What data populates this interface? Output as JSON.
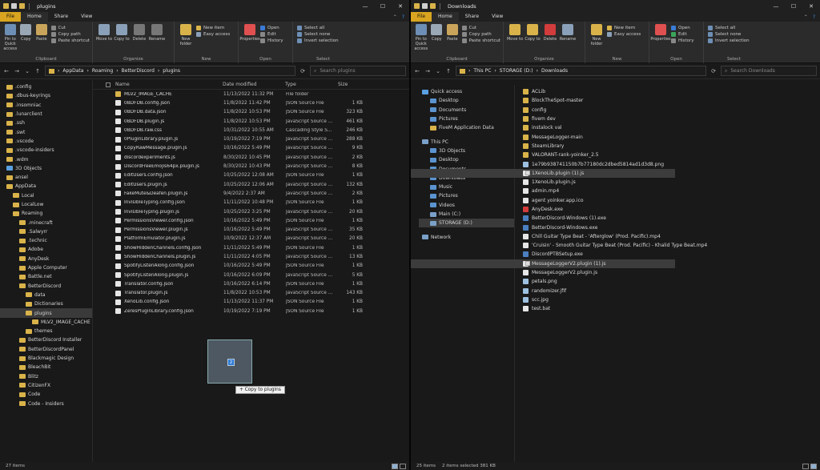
{
  "left": {
    "title": "plugins",
    "tabs": [
      "File",
      "Home",
      "Share",
      "View"
    ],
    "ribbon": {
      "clipboard": {
        "label": "Clipboard",
        "pin": "Pin to Quick access",
        "copy": "Copy",
        "paste": "Paste",
        "cut": "Cut",
        "copy_path": "Copy path",
        "paste_shortcut": "Paste shortcut"
      },
      "organize": {
        "label": "Organize",
        "move_to": "Move to",
        "copy_to": "Copy to",
        "delete": "Delete",
        "rename": "Rename"
      },
      "new": {
        "label": "New",
        "new_folder": "New folder",
        "new_item": "New item",
        "easy_access": "Easy access"
      },
      "open": {
        "label": "Open",
        "properties": "Properties",
        "open": "Open",
        "edit": "Edit",
        "history": "History"
      },
      "select": {
        "label": "Select",
        "select_all": "Select all",
        "select_none": "Select none",
        "invert": "Invert selection"
      }
    },
    "path": [
      "AppData",
      "Roaming",
      "BetterDiscord",
      "plugins"
    ],
    "search_placeholder": "Search plugins",
    "columns": {
      "name": "Name",
      "date": "Date modified",
      "type": "Type",
      "size": "Size"
    },
    "nav": [
      ".config",
      ".dbus-keyrings",
      ".insomniac",
      ".lunarclient",
      ".ssh",
      ".swt",
      ".vscode",
      ".vscode-insiders",
      ".wdm",
      "3D Objects",
      "ansel",
      "AppData",
      "Local",
      "LocalLow",
      "Roaming",
      ".minecraft",
      ".Salwyrr",
      ".technic",
      "Adobe",
      "AnyDesk",
      "Apple Computer",
      "Battle.net",
      "BetterDiscord",
      "data",
      "Dictionaries",
      "plugins",
      "MLV2_IMAGE_CACHE",
      "themes",
      "BetterDiscord Installer",
      "BetterDiscordPanel",
      "Blackmagic Design",
      "BleachBit",
      "Blitz",
      "CitizenFX",
      "Code",
      "Code - Insiders"
    ],
    "files": [
      {
        "name": "MLV2_IMAGE_CACHE",
        "date": "11/13/2022 11:32 PM",
        "type": "File folder",
        "size": ""
      },
      {
        "name": "0BDFDB.config.json",
        "date": "11/8/2022 11:42 PM",
        "type": "JSON Source File",
        "size": "1 KB"
      },
      {
        "name": "0BDFDB.data.json",
        "date": "11/8/2022 10:53 PM",
        "type": "JSON Source File",
        "size": "323 KB"
      },
      {
        "name": "0BDFDB.plugin.js",
        "date": "11/8/2022 10:53 PM",
        "type": "JavaScript Source ...",
        "size": "461 KB"
      },
      {
        "name": "0BDFDB.raw.css",
        "date": "10/31/2022 10:55 AM",
        "type": "Cascading Style S...",
        "size": "246 KB"
      },
      {
        "name": "0PluginLibrary.plugin.js",
        "date": "10/19/2022 7:19 PM",
        "type": "JavaScript Source ...",
        "size": "288 KB"
      },
      {
        "name": "CopyRawMessage.plugin.js",
        "date": "10/16/2022 5:49 PM",
        "type": "JavaScript Source ...",
        "size": "9 KB"
      },
      {
        "name": "discordexperiments.js",
        "date": "8/30/2022 10:45 PM",
        "type": "JavaScript Source ...",
        "size": "2 KB"
      },
      {
        "name": "DiscordFreeEmojis64px.plugin.js",
        "date": "8/30/2022 10:43 PM",
        "type": "JavaScript Source ...",
        "size": "8 KB"
      },
      {
        "name": "EditUsers.config.json",
        "date": "10/25/2022 12:08 AM",
        "type": "JSON Source File",
        "size": "1 KB"
      },
      {
        "name": "EditUsers.plugin.js",
        "date": "10/25/2022 12:06 AM",
        "type": "JavaScript Source ...",
        "size": "132 KB"
      },
      {
        "name": "FakeMute&Deafen.plugin.js",
        "date": "9/4/2022 2:37 AM",
        "type": "JavaScript Source ...",
        "size": "2 KB"
      },
      {
        "name": "InvisibleTyping.config.json",
        "date": "11/11/2022 10:48 PM",
        "type": "JSON Source File",
        "size": "1 KB"
      },
      {
        "name": "InvisibleTyping.plugin.js",
        "date": "10/25/2022 3:25 PM",
        "type": "JavaScript Source ...",
        "size": "20 KB"
      },
      {
        "name": "PermissionsViewer.config.json",
        "date": "10/16/2022 5:49 PM",
        "type": "JSON Source File",
        "size": "1 KB"
      },
      {
        "name": "PermissionsViewer.plugin.js",
        "date": "10/16/2022 5:49 PM",
        "type": "JavaScript Source ...",
        "size": "35 KB"
      },
      {
        "name": "PlatformEmulator.plugin.js",
        "date": "10/9/2022 12:37 AM",
        "type": "JavaScript Source ...",
        "size": "20 KB"
      },
      {
        "name": "ShowHiddenChannels.config.json",
        "date": "11/11/2022 5:49 PM",
        "type": "JSON Source File",
        "size": "1 KB"
      },
      {
        "name": "ShowHiddenChannels.plugin.js",
        "date": "11/11/2022 4:05 PM",
        "type": "JavaScript Source ...",
        "size": "13 KB"
      },
      {
        "name": "SpotifyListenAlong.config.json",
        "date": "10/16/2022 5:49 PM",
        "type": "JSON Source File",
        "size": "1 KB"
      },
      {
        "name": "SpotifyListenAlong.plugin.js",
        "date": "10/16/2022 6:09 PM",
        "type": "JavaScript Source ...",
        "size": "5 KB"
      },
      {
        "name": "Translator.config.json",
        "date": "10/16/2022 6:14 PM",
        "type": "JSON Source File",
        "size": "1 KB"
      },
      {
        "name": "Translator.plugin.js",
        "date": "11/8/2022 10:53 PM",
        "type": "JavaScript Source ...",
        "size": "143 KB"
      },
      {
        "name": "XenoLib.config.json",
        "date": "11/13/2022 11:37 PM",
        "type": "JSON Source File",
        "size": "1 KB"
      },
      {
        "name": "ZeresPluginLibrary.config.json",
        "date": "10/19/2022 7:19 PM",
        "type": "JSON Source File",
        "size": "1 KB"
      }
    ],
    "drag_badge": "2",
    "drag_tip": "Copy to plugins"
  },
  "right": {
    "title": "Downloads",
    "tabs": [
      "File",
      "Home",
      "Share",
      "View"
    ],
    "path": [
      "This PC",
      "STORAGE (D:)",
      "Downloads"
    ],
    "search_placeholder": "Search Downloads",
    "nav": [
      {
        "label": "Quick access",
        "kind": "head"
      },
      {
        "label": "Desktop",
        "kind": "item"
      },
      {
        "label": "Documents",
        "kind": "item"
      },
      {
        "label": "Pictures",
        "kind": "item"
      },
      {
        "label": "FiveM Application Data",
        "kind": "item"
      },
      {
        "label": "",
        "kind": "gap"
      },
      {
        "label": "This PC",
        "kind": "head2"
      },
      {
        "label": "3D Objects",
        "kind": "item"
      },
      {
        "label": "Desktop",
        "kind": "item"
      },
      {
        "label": "Documents",
        "kind": "item"
      },
      {
        "label": "Downloads",
        "kind": "item"
      },
      {
        "label": "Music",
        "kind": "item"
      },
      {
        "label": "Pictures",
        "kind": "item"
      },
      {
        "label": "Videos",
        "kind": "item"
      },
      {
        "label": "Main (C:)",
        "kind": "item"
      },
      {
        "label": "STORAGE (D:)",
        "kind": "sel"
      },
      {
        "label": "",
        "kind": "gap"
      },
      {
        "label": "Network",
        "kind": "head2"
      }
    ],
    "files": [
      {
        "name": "ACLib",
        "kind": "folder"
      },
      {
        "name": "BlockTheSpot-master",
        "kind": "folder"
      },
      {
        "name": "config",
        "kind": "folder"
      },
      {
        "name": "fivem dev",
        "kind": "folder"
      },
      {
        "name": "instalock val",
        "kind": "folder"
      },
      {
        "name": "MessageLogger-main",
        "kind": "folder"
      },
      {
        "name": "SteamLibrary",
        "kind": "folder"
      },
      {
        "name": "VALORANT-rank-yoinker_2.5",
        "kind": "folder"
      },
      {
        "name": "1e79b938741150b7b77180dc2dbed5814ad1d3d8.png",
        "kind": "img"
      },
      {
        "name": "1XenoLib.plugin (1).js",
        "kind": "sel"
      },
      {
        "name": "1XenoLib.plugin.js",
        "kind": "file"
      },
      {
        "name": "admin.mp4",
        "kind": "file"
      },
      {
        "name": "agent yoinker.app.ico",
        "kind": "file"
      },
      {
        "name": "AnyDesk.exe",
        "kind": "red"
      },
      {
        "name": "BetterDiscord-Windows (1).exe",
        "kind": "exe"
      },
      {
        "name": "BetterDiscord-Windows.exe",
        "kind": "exe"
      },
      {
        "name": "Chill Guitar Type Beat - 'Afterglow' (Prod. Pacific).mp4",
        "kind": "file"
      },
      {
        "name": "'Cruisin' - Smooth Guitar Type Beat (Prod. Pacific) - Khalid Type Beat.mp4",
        "kind": "file"
      },
      {
        "name": "DiscordPTBSetup.exe",
        "kind": "exe"
      },
      {
        "name": "MessageLoggerV2.plugin (1).js",
        "kind": "sel"
      },
      {
        "name": "MessageLoggerV2.plugin.js",
        "kind": "file"
      },
      {
        "name": "petals.png",
        "kind": "img"
      },
      {
        "name": "randomizer.jfif",
        "kind": "img"
      },
      {
        "name": "scc.jpg",
        "kind": "img"
      },
      {
        "name": "test.bat",
        "kind": "file"
      }
    ],
    "status": {
      "count": "25 items",
      "selected": "2 items selected  381 KB"
    }
  },
  "left_status": {
    "count": "27 items"
  }
}
